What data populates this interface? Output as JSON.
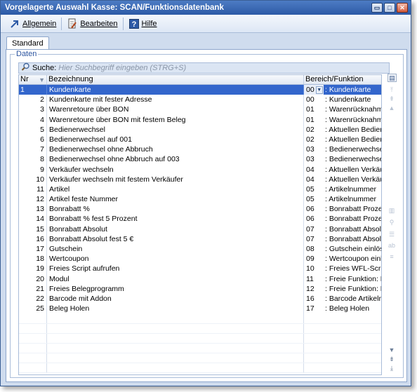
{
  "window": {
    "title": "Vorgelagerte Auswahl Kasse: SCAN/Funktionsdatenbank",
    "buttons": [
      "▭",
      "□",
      "✕"
    ]
  },
  "toolbar": {
    "allgemein": "Allgemein",
    "bearbeiten": "Bearbeiten",
    "hilfe": "Hilfe"
  },
  "tabs": {
    "standard": "Standard"
  },
  "group": {
    "legend": "Daten"
  },
  "search": {
    "label": "Suche:",
    "placeholder": "Hier Suchbegriff eingeben (STRG+S)",
    "value": ""
  },
  "grid": {
    "headers": {
      "nr": "Nr",
      "bezeichnung": "Bezeichnung",
      "bereich": "Bereich/Funktion"
    },
    "rows": [
      {
        "nr": "1",
        "bez": "Kundenkarte",
        "code": "00",
        "func": ": Kundenkarte"
      },
      {
        "nr": "2",
        "bez": "Kundenkarte mit fester Adresse",
        "code": "00",
        "func": ": Kundenkarte"
      },
      {
        "nr": "3",
        "bez": "Warenretoure über BON",
        "code": "01",
        "func": ": Warenrücknahme"
      },
      {
        "nr": "4",
        "bez": "Warenretoure über BON mit festem Beleg",
        "code": "01",
        "func": ": Warenrücknahme"
      },
      {
        "nr": "5",
        "bez": "Bedienerwechsel",
        "code": "02",
        "func": ": Aktuellen Bediener"
      },
      {
        "nr": "6",
        "bez": "Bedienerwechsel auf 001",
        "code": "02",
        "func": ": Aktuellen Bediener"
      },
      {
        "nr": "7",
        "bez": "Bedienerwechsel ohne Abbruch",
        "code": "03",
        "func": ": Bedienerwechsel"
      },
      {
        "nr": "8",
        "bez": "Bedienerwechsel ohne Abbruch auf 003",
        "code": "03",
        "func": ": Bedienerwechsel"
      },
      {
        "nr": "9",
        "bez": "Verkäufer wechseln",
        "code": "04",
        "func": ": Aktuellen Verkäufer"
      },
      {
        "nr": "10",
        "bez": "Verkäufer wechseln mit festem Verkäufer",
        "code": "04",
        "func": ": Aktuellen Verkäufer"
      },
      {
        "nr": "11",
        "bez": "Artikel",
        "code": "05",
        "func": ": Artikelnummer"
      },
      {
        "nr": "12",
        "bez": "Artikel feste Nummer",
        "code": "05",
        "func": ": Artikelnummer"
      },
      {
        "nr": "13",
        "bez": "Bonrabatt %",
        "code": "06",
        "func": ": Bonrabatt Prozent"
      },
      {
        "nr": "14",
        "bez": "Bonrabatt % fest 5 Prozent",
        "code": "06",
        "func": ": Bonrabatt Prozent"
      },
      {
        "nr": "15",
        "bez": "Bonrabatt Absolut",
        "code": "07",
        "func": ": Bonrabatt Absolut"
      },
      {
        "nr": "16",
        "bez": "Bonrabatt Absolut fest 5 €",
        "code": "07",
        "func": ": Bonrabatt Absolut"
      },
      {
        "nr": "17",
        "bez": "Gutschein",
        "code": "08",
        "func": ": Gutschein einlösen"
      },
      {
        "nr": "18",
        "bez": "Wertcoupon",
        "code": "09",
        "func": ": Wertcoupon einlösen"
      },
      {
        "nr": "19",
        "bez": "Freies Script aufrufen",
        "code": "10",
        "func": ": Freies WFL-Script"
      },
      {
        "nr": "20",
        "bez": "Modul",
        "code": "11",
        "func": ": Freie Funktion: B"
      },
      {
        "nr": "21",
        "bez": "Freies Belegprogramm",
        "code": "12",
        "func": ": Freie Funktion: B"
      },
      {
        "nr": "22",
        "bez": "Barcode mit Addon",
        "code": "16",
        "func": ": Barcode Artikelnummer"
      },
      {
        "nr": "25",
        "bez": "Beleg Holen",
        "code": "17",
        "func": ": Beleg Holen"
      }
    ],
    "empty_rows": 6
  },
  "colors": {
    "selection": "#3366cc",
    "title_bar": "#2d5aa6",
    "frame": "#cfdcee"
  },
  "icons": {
    "allgemein": "arrow-icon",
    "bearbeiten": "edit-icon",
    "hilfe": "help-icon",
    "search": "search-icon"
  }
}
